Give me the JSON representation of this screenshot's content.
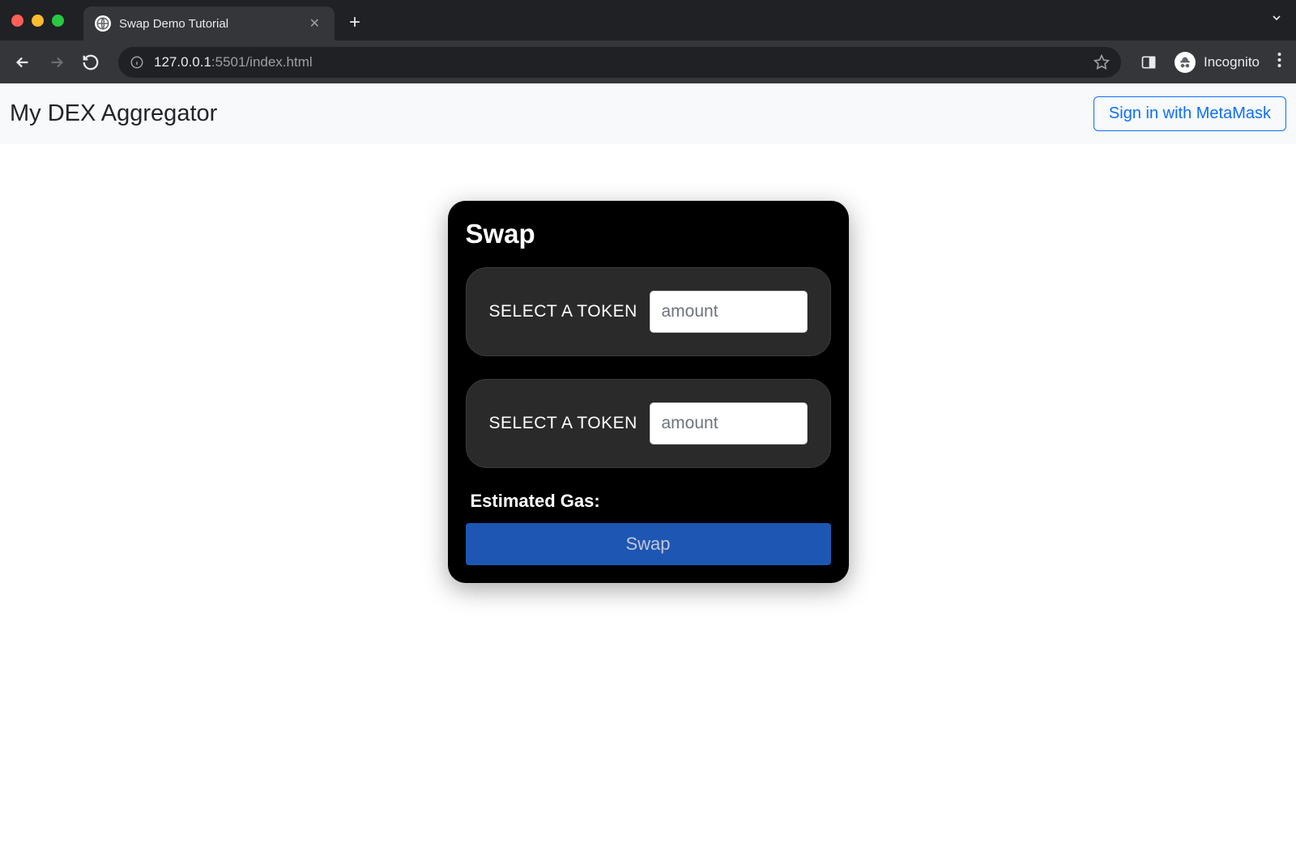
{
  "browser": {
    "tab_title": "Swap Demo Tutorial",
    "url_host": "127.0.0.1",
    "url_path": ":5501/index.html",
    "incognito_label": "Incognito"
  },
  "navbar": {
    "brand": "My DEX Aggregator",
    "signin_label": "Sign in with MetaMask"
  },
  "swap": {
    "title": "Swap",
    "from": {
      "select_label": "SELECT A TOKEN",
      "amount_placeholder": "amount",
      "amount_value": ""
    },
    "to": {
      "select_label": "SELECT A TOKEN",
      "amount_placeholder": "amount",
      "amount_value": ""
    },
    "gas_label": "Estimated Gas:",
    "button_label": "Swap"
  }
}
